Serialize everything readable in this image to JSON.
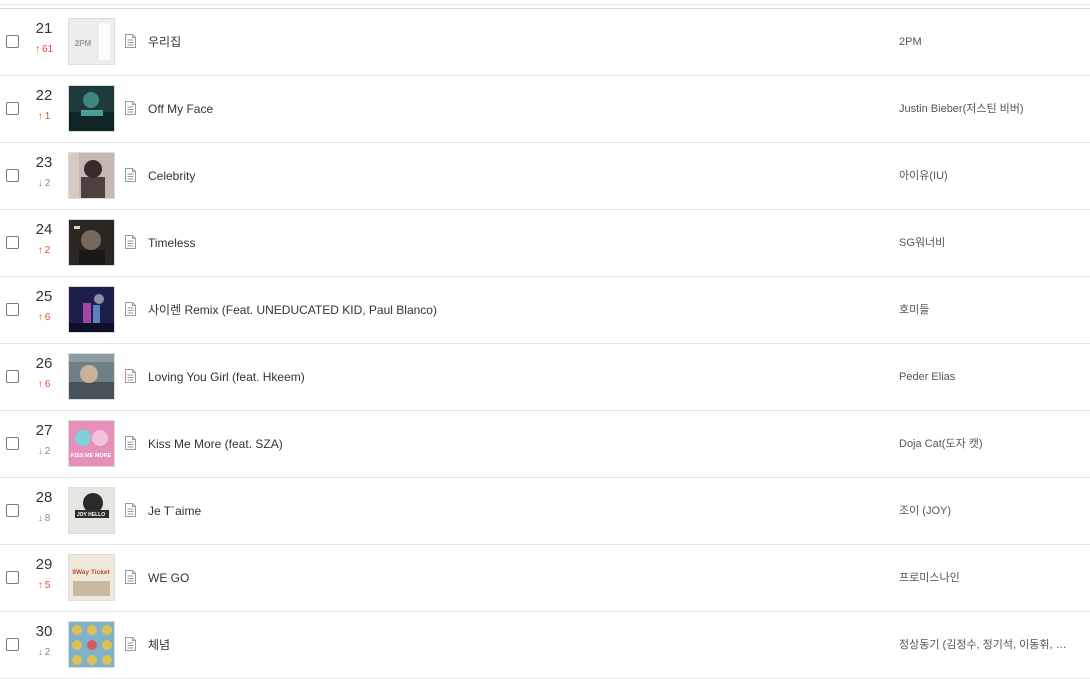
{
  "chart": {
    "rows": [
      {
        "rank": "21",
        "change_dir": "up",
        "change_value": "61",
        "title": "우리집",
        "artist": "2PM",
        "cover": {
          "bg": "#ededed",
          "accent": "#9a9a9a",
          "text": "2PM",
          "style": "logo"
        }
      },
      {
        "rank": "22",
        "change_dir": "up",
        "change_value": "1",
        "title": "Off My Face",
        "artist": "Justin Bieber(저스틴 비버)",
        "cover": {
          "bg": "#1e3a3a",
          "accent": "#5fd0c8",
          "text": "",
          "style": "dark"
        }
      },
      {
        "rank": "23",
        "change_dir": "down",
        "change_value": "2",
        "title": "Celebrity",
        "artist": "아이유(IU)",
        "cover": {
          "bg": "#c7b7b2",
          "accent": "#3a2a2a",
          "text": "",
          "style": "portrait"
        }
      },
      {
        "rank": "24",
        "change_dir": "up",
        "change_value": "2",
        "title": "Timeless",
        "artist": "SG워너비",
        "cover": {
          "bg": "#2a2622",
          "accent": "#8a7a6a",
          "text": "",
          "style": "portrait-dark"
        }
      },
      {
        "rank": "25",
        "change_dir": "up",
        "change_value": "6",
        "title": "사이렌 Remix (Feat. UNEDUCATED KID, Paul Blanco)",
        "artist": "호미들",
        "cover": {
          "bg": "#1b1f4a",
          "accent": "#c84fb8",
          "text": "",
          "style": "night"
        }
      },
      {
        "rank": "26",
        "change_dir": "up",
        "change_value": "6",
        "title": "Loving You Girl (feat. Hkeem)",
        "artist": "Peder Elias",
        "cover": {
          "bg": "#6e7f86",
          "accent": "#c9b29a",
          "text": "",
          "style": "photo"
        }
      },
      {
        "rank": "27",
        "change_dir": "down",
        "change_value": "2",
        "title": "Kiss Me More (feat. SZA)",
        "artist": "Doja Cat(도자 캣)",
        "cover": {
          "bg": "#e58fb9",
          "accent": "#7dd3d8",
          "text": "KISS ME MORE",
          "style": "pink"
        }
      },
      {
        "rank": "28",
        "change_dir": "down",
        "change_value": "8",
        "title": "Je T´aime",
        "artist": "조이 (JOY)",
        "cover": {
          "bg": "#e8e6e1",
          "accent": "#2a2a2a",
          "text": "JOY HELLO",
          "style": "light"
        }
      },
      {
        "rank": "29",
        "change_dir": "up",
        "change_value": "5",
        "title": "WE GO",
        "artist": "프로미스나인",
        "cover": {
          "bg": "#efe9dc",
          "accent": "#c5463a",
          "text": "9Way Ticket",
          "style": "ticket"
        }
      },
      {
        "rank": "30",
        "change_dir": "down",
        "change_value": "2",
        "title": "체념",
        "artist": "정상동기 (김정수, 정기석, 이동휘, …",
        "cover": {
          "bg": "#7fb2c9",
          "accent": "#e7c24a",
          "text": "",
          "style": "grid"
        }
      }
    ]
  }
}
